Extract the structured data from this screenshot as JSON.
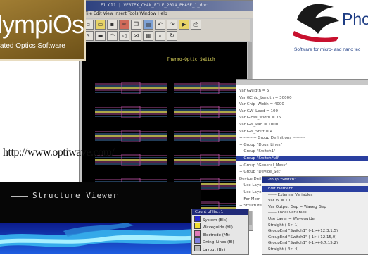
{
  "olympios_logo": {
    "name": "lympiOs",
    "tagline": "ated Optics Software"
  },
  "phoenix_logo": {
    "name": "Phoe",
    "tagline": "Software for micro- and nano tec"
  },
  "main_window": {
    "title": "E1 Cl1 | VERTEX_CHAN_FILE_2014_PHASE_1_doc",
    "menu": "File  Edit  View  Insert  Tools  Window  Help",
    "canvas_title": "Thermo-Optic Switch"
  },
  "tree": {
    "rows": [
      "Var GWidth = 5",
      "Var GChip_Length = 30000",
      "Var Chip_Width = 4000",
      "Var GW_Lead = 100",
      "Var Gloss_Width = 75",
      "Var GW_Pad = 1000",
      "Var GW_Shift = 4",
      "+---------- Group Definitions ---------",
      "+ Group \"Dbus_Lines\"",
      "+ Group \"Switch1\"",
      "+ Group \"SwitchFull\"",
      "+ Group \"General_Mask\"",
      "+ Group \"Device_Set\"",
      "      Device Definitions",
      "+ Use Layer",
      "+ Use Layer",
      "+ For Mem",
      "+ Structure"
    ],
    "selected_index": 10
  },
  "edit_dialog": {
    "title": "Group \"Switch\"",
    "rows": [
      "Edit Element",
      "  ------ External Variables",
      "Var W = 10",
      "Var Output_Sep = Waveg_Sep",
      "  ------ Local Variables",
      "Use Layer = Waveguide",
      "Straight (-6>-1)",
      "GroupEnd \"Switch1\" (-1>+12.3,1.5)",
      "GroupEnd \"Switch1\" (-1>+12.15,0)",
      "GroupEnd \"Switch1\" (-1>+6.7,15.2)",
      "Straight (-4>-4)"
    ]
  },
  "layer_panel": {
    "header": "Count of list: 1",
    "layers": [
      {
        "label": "System (Blk)",
        "color": "#2a2ad0"
      },
      {
        "label": "Waveguide (Yll)",
        "color": "#f0e030"
      },
      {
        "label": "Electrode (Mt)",
        "color": "#e07ab8"
      },
      {
        "label": "Dning_Lines (Bl)",
        "color": "#8080e0"
      },
      {
        "label": "Layout (Blr)",
        "color": "#bbbbbb"
      }
    ]
  },
  "structure_viewer": {
    "title": "Structure Viewer"
  },
  "url_watermark": "http://www.optiwave.com/"
}
